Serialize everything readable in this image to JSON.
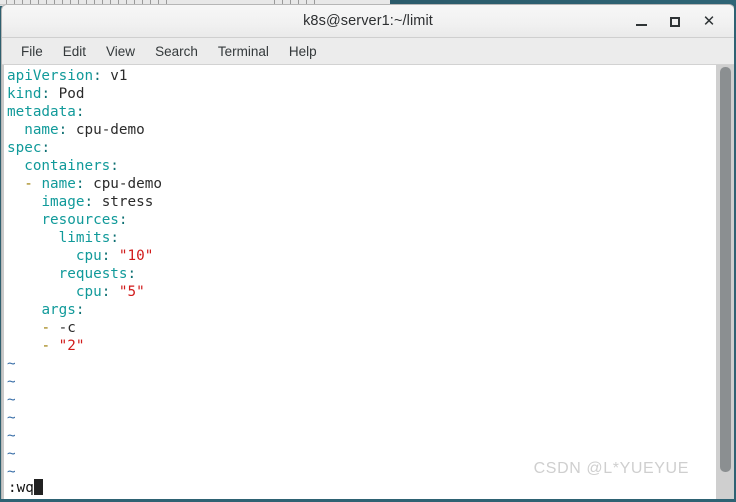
{
  "window": {
    "title": "k8s@server1:~/limit",
    "controls": {
      "minimize": "minimize-button",
      "maximize": "maximize-button",
      "close": "✕"
    }
  },
  "menubar": {
    "items": [
      {
        "label": "File"
      },
      {
        "label": "Edit"
      },
      {
        "label": "View"
      },
      {
        "label": "Search"
      },
      {
        "label": "Terminal"
      },
      {
        "label": "Help"
      }
    ]
  },
  "editor": {
    "lines": [
      {
        "indent": "",
        "key": "apiVersion",
        "colon": ":",
        "value": " v1",
        "value_class": "v"
      },
      {
        "indent": "",
        "key": "kind",
        "colon": ":",
        "value": " Pod",
        "value_class": "v"
      },
      {
        "indent": "",
        "key": "metadata",
        "colon": ":",
        "value": "",
        "value_class": "v"
      },
      {
        "indent": "  ",
        "key": "name",
        "colon": ":",
        "value": " cpu-demo",
        "value_class": "v"
      },
      {
        "indent": "",
        "key": "spec",
        "colon": ":",
        "value": "",
        "value_class": "v"
      },
      {
        "indent": "  ",
        "key": "containers",
        "colon": ":",
        "value": "",
        "value_class": "v"
      },
      {
        "indent": "  ",
        "dash": "- ",
        "key": "name",
        "colon": ":",
        "value": " cpu-demo",
        "value_class": "v"
      },
      {
        "indent": "    ",
        "key": "image",
        "colon": ":",
        "value": " stress",
        "value_class": "v"
      },
      {
        "indent": "    ",
        "key": "resources",
        "colon": ":",
        "value": "",
        "value_class": "v"
      },
      {
        "indent": "      ",
        "key": "limits",
        "colon": ":",
        "value": "",
        "value_class": "v"
      },
      {
        "indent": "        ",
        "key": "cpu",
        "colon": ":",
        "value": " \"10\"",
        "value_class": "s"
      },
      {
        "indent": "      ",
        "key": "requests",
        "colon": ":",
        "value": "",
        "value_class": "v"
      },
      {
        "indent": "        ",
        "key": "cpu",
        "colon": ":",
        "value": " \"5\"",
        "value_class": "s"
      },
      {
        "indent": "    ",
        "key": "args",
        "colon": ":",
        "value": "",
        "value_class": "v"
      },
      {
        "indent": "    ",
        "dash": "- ",
        "key": "",
        "colon": "",
        "value": "-c",
        "value_class": "v"
      },
      {
        "indent": "    ",
        "dash": "- ",
        "key": "",
        "colon": "",
        "value": "\"2\"",
        "value_class": "s"
      }
    ],
    "empty_markers": [
      "~",
      "~",
      "~",
      "~",
      "~",
      "~",
      "~"
    ],
    "command_line": ":wq"
  },
  "watermark": {
    "text": "CSDN @L*YUEYUE"
  },
  "colors": {
    "key_teal": "#119a9a",
    "string_red": "#d11b1b",
    "dash_olive": "#9a7a00",
    "tilde_blue": "#3a6fa8",
    "desktop_teal": "#2e6273"
  }
}
